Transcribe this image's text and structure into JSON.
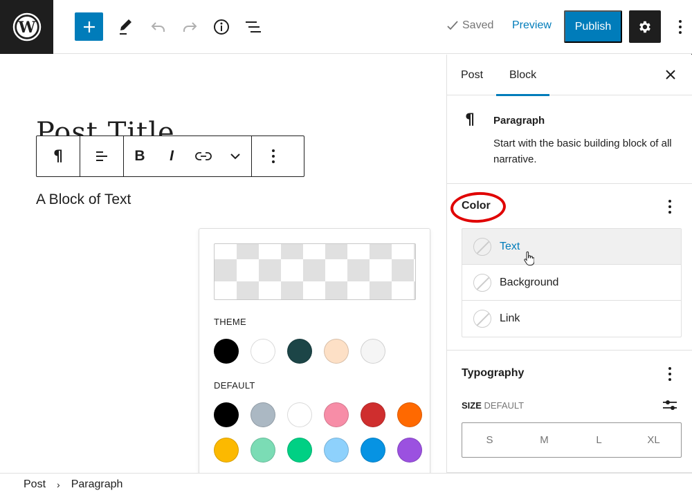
{
  "topbar": {
    "logo_icon": "wordpress-logo-icon",
    "add_block_icon": "plus-icon",
    "tools_icon": "pencil-icon",
    "undo_icon": "undo-icon",
    "redo_icon": "redo-icon",
    "details_icon": "info-icon",
    "list_view_icon": "list-view-icon",
    "saved_label": "Saved",
    "preview_label": "Preview",
    "publish_label": "Publish",
    "settings_icon": "gear-icon",
    "options_icon": "kebab-icon"
  },
  "editor": {
    "post_title": "Post Title",
    "block_text": "A Block of Text",
    "toolbar": {
      "paragraph_icon": "¶",
      "bold_label": "B",
      "italic_label": "I"
    }
  },
  "color_popover": {
    "theme_label": "THEME",
    "default_label": "DEFAULT",
    "theme_colors": [
      "#000000",
      "#ffffff",
      "#1c4547",
      "#fde0c6",
      "#f5f5f5"
    ],
    "default_colors": [
      "#000000",
      "#abb8c3",
      "#ffffff",
      "#f78da7",
      "#cf2e2e",
      "#ff6900",
      "#fcb900",
      "#7bdcb5",
      "#00d084",
      "#8ed1fc",
      "#0693e3",
      "#9b51e0"
    ]
  },
  "sidebar": {
    "tabs": [
      {
        "label": "Post",
        "active": false
      },
      {
        "label": "Block",
        "active": true
      }
    ],
    "block_card": {
      "icon": "¶",
      "name": "Paragraph",
      "description": "Start with the basic building block of all narrative."
    },
    "color_panel": {
      "title": "Color",
      "items": [
        "Text",
        "Background",
        "Link"
      ]
    },
    "typography_panel": {
      "title": "Typography",
      "size_label": "SIZE",
      "size_value": "DEFAULT",
      "sizes": [
        "S",
        "M",
        "L",
        "XL"
      ]
    }
  },
  "breadcrumb": {
    "items": [
      "Post",
      "Paragraph"
    ]
  },
  "colors": {
    "accent": "#007cba",
    "dark": "#1e1e1e",
    "highlight": "#e00000"
  }
}
